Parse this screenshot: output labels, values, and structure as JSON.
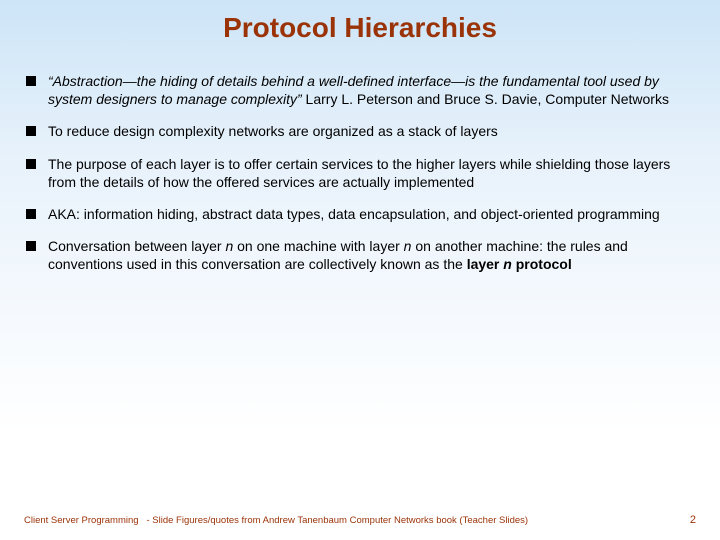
{
  "title": "Protocol Hierarchies",
  "bullets": [
    {
      "parts": [
        {
          "text": "“Abstraction—the hiding of details behind a well-defined interface—is the fundamental tool used by system designers to manage complexity”",
          "italic": true
        },
        {
          "text": " Larry L. Peterson and Bruce S. Davie, Computer Networks",
          "italic": false
        }
      ]
    },
    {
      "parts": [
        {
          "text": "To reduce design complexity networks are organized as a stack of layers"
        }
      ]
    },
    {
      "parts": [
        {
          "text": "The purpose of each layer is to offer certain services to the higher layers while shielding those layers from the details of how the offered services are actually implemented"
        }
      ]
    },
    {
      "parts": [
        {
          "text": "AKA: information hiding, abstract data types, data encapsulation, and object-oriented programming"
        }
      ]
    },
    {
      "parts": [
        {
          "text": "Conversation between layer "
        },
        {
          "text": "n",
          "italic": true
        },
        {
          "text": " on one machine with layer "
        },
        {
          "text": "n",
          "italic": true
        },
        {
          "text": " on another machine: the rules and conventions used in this conversation are collectively known as the "
        },
        {
          "text": "layer ",
          "bold": true
        },
        {
          "text": "n",
          "bold": true,
          "italic": true
        },
        {
          "text": " protocol",
          "bold": true
        }
      ]
    }
  ],
  "footer": {
    "left": "Client Server Programming   - Slide Figures/quotes from Andrew Tanenbaum Computer Networks book (Teacher Slides)",
    "right": "2"
  }
}
